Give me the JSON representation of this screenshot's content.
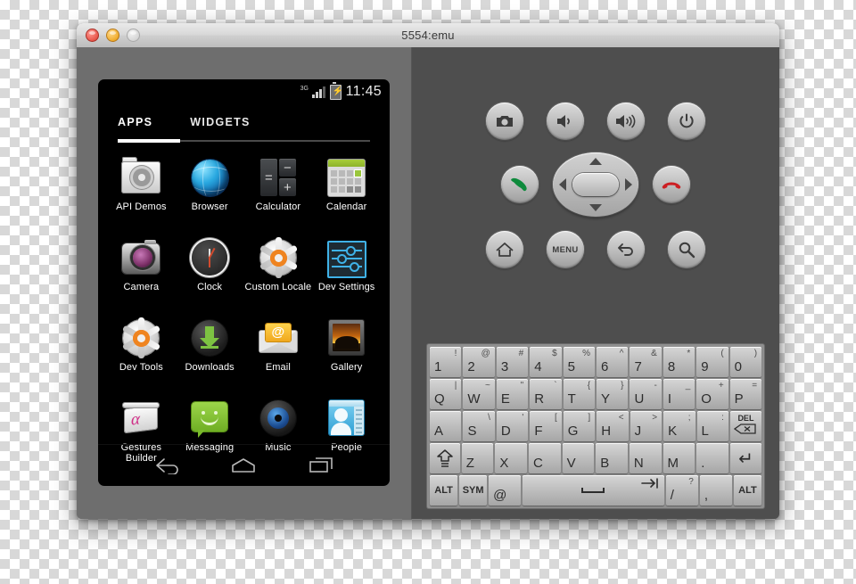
{
  "window": {
    "title": "5554:emu",
    "traffic_lights": [
      "close",
      "minimize",
      "zoom"
    ]
  },
  "device": {
    "statusbar": {
      "network": "3G",
      "battery": "charging",
      "time": "11:45"
    },
    "tabs": [
      {
        "label": "APPS",
        "active": true
      },
      {
        "label": "WIDGETS",
        "active": false
      }
    ],
    "apps": [
      {
        "label": "API Demos",
        "icon": "folder-gear-icon"
      },
      {
        "label": "Browser",
        "icon": "globe-icon"
      },
      {
        "label": "Calculator",
        "icon": "calculator-icon"
      },
      {
        "label": "Calendar",
        "icon": "calendar-icon"
      },
      {
        "label": "Camera",
        "icon": "camera-icon"
      },
      {
        "label": "Clock",
        "icon": "clock-icon"
      },
      {
        "label": "Custom Locale",
        "icon": "gear-orange-icon"
      },
      {
        "label": "Dev Settings",
        "icon": "sliders-icon"
      },
      {
        "label": "Dev Tools",
        "icon": "gear-orange-icon"
      },
      {
        "label": "Downloads",
        "icon": "download-arrow-icon"
      },
      {
        "label": "Email",
        "icon": "envelope-at-icon"
      },
      {
        "label": "Gallery",
        "icon": "photo-frame-icon"
      },
      {
        "label": "Gestures Builder",
        "icon": "gesture-pad-icon"
      },
      {
        "label": "Messaging",
        "icon": "speech-bubble-icon"
      },
      {
        "label": "Music",
        "icon": "speaker-icon"
      },
      {
        "label": "People",
        "icon": "contact-card-icon"
      }
    ],
    "navbar": [
      {
        "name": "back",
        "icon": "back-arrow-icon"
      },
      {
        "name": "home",
        "icon": "home-icon"
      },
      {
        "name": "recents",
        "icon": "recents-icon"
      }
    ]
  },
  "controls": {
    "row1": [
      {
        "name": "camera",
        "icon": "camera-icon"
      },
      {
        "name": "volume-down",
        "icon": "volume-down-icon"
      },
      {
        "name": "volume-up",
        "icon": "volume-up-icon"
      },
      {
        "name": "power",
        "icon": "power-icon"
      }
    ],
    "row2": [
      {
        "name": "call",
        "icon": "call-green-icon"
      },
      {
        "name": "dpad",
        "icon": "dpad-icon"
      },
      {
        "name": "end-call",
        "icon": "end-call-red-icon"
      }
    ],
    "row3": [
      {
        "name": "home",
        "icon": "home-icon",
        "label": ""
      },
      {
        "name": "menu",
        "icon": "",
        "label": "MENU"
      },
      {
        "name": "back",
        "icon": "back-arrow-icon",
        "label": ""
      },
      {
        "name": "search",
        "icon": "search-icon",
        "label": ""
      }
    ]
  },
  "keyboard": {
    "rows": [
      [
        {
          "main": "1",
          "sup": "!"
        },
        {
          "main": "2",
          "sup": "@"
        },
        {
          "main": "3",
          "sup": "#"
        },
        {
          "main": "4",
          "sup": "$"
        },
        {
          "main": "5",
          "sup": "%"
        },
        {
          "main": "6",
          "sup": "^"
        },
        {
          "main": "7",
          "sup": "&"
        },
        {
          "main": "8",
          "sup": "*"
        },
        {
          "main": "9",
          "sup": "("
        },
        {
          "main": "0",
          "sup": ")"
        }
      ],
      [
        {
          "main": "Q",
          "sup": "|"
        },
        {
          "main": "W",
          "sup": "~"
        },
        {
          "main": "E",
          "sup": "\""
        },
        {
          "main": "R",
          "sup": "`"
        },
        {
          "main": "T",
          "sup": "{"
        },
        {
          "main": "Y",
          "sup": "}"
        },
        {
          "main": "U",
          "sup": "-"
        },
        {
          "main": "I",
          "sup": "_"
        },
        {
          "main": "O",
          "sup": "+"
        },
        {
          "main": "P",
          "sup": "="
        }
      ],
      [
        {
          "main": "A",
          "sup": ""
        },
        {
          "main": "S",
          "sup": "\\"
        },
        {
          "main": "D",
          "sup": "'"
        },
        {
          "main": "F",
          "sup": "["
        },
        {
          "main": "G",
          "sup": "]"
        },
        {
          "main": "H",
          "sup": "<"
        },
        {
          "main": "J",
          "sup": ">"
        },
        {
          "main": "K",
          "sup": ";"
        },
        {
          "main": "L",
          "sup": ":"
        },
        {
          "main": "DEL",
          "sup": "",
          "key": "del"
        }
      ],
      [
        {
          "main": "",
          "sup": "",
          "key": "shift"
        },
        {
          "main": "Z",
          "sup": ""
        },
        {
          "main": "X",
          "sup": ""
        },
        {
          "main": "C",
          "sup": ""
        },
        {
          "main": "V",
          "sup": ""
        },
        {
          "main": "B",
          "sup": ""
        },
        {
          "main": "N",
          "sup": ""
        },
        {
          "main": "M",
          "sup": ""
        },
        {
          "main": ".",
          "sup": ""
        },
        {
          "main": "↵",
          "sup": "",
          "key": "enter"
        }
      ],
      [
        {
          "main": "ALT",
          "sup": "",
          "key": "alt"
        },
        {
          "main": "SYM",
          "sup": "",
          "key": "sym"
        },
        {
          "main": "@",
          "sup": ""
        },
        {
          "main": "",
          "sup": "",
          "key": "space"
        },
        {
          "main": "/",
          "sup": "?"
        },
        {
          "main": ",",
          "sup": ""
        },
        {
          "main": "ALT",
          "sup": "",
          "key": "alt"
        }
      ]
    ],
    "del_label": "DEL"
  },
  "colors": {
    "window_chrome": "#6e6e6e",
    "control_pane": "#4e4e4e",
    "screen_bg": "#000000",
    "accent_blue": "#3fb2e8",
    "accent_green": "#7dc242"
  }
}
